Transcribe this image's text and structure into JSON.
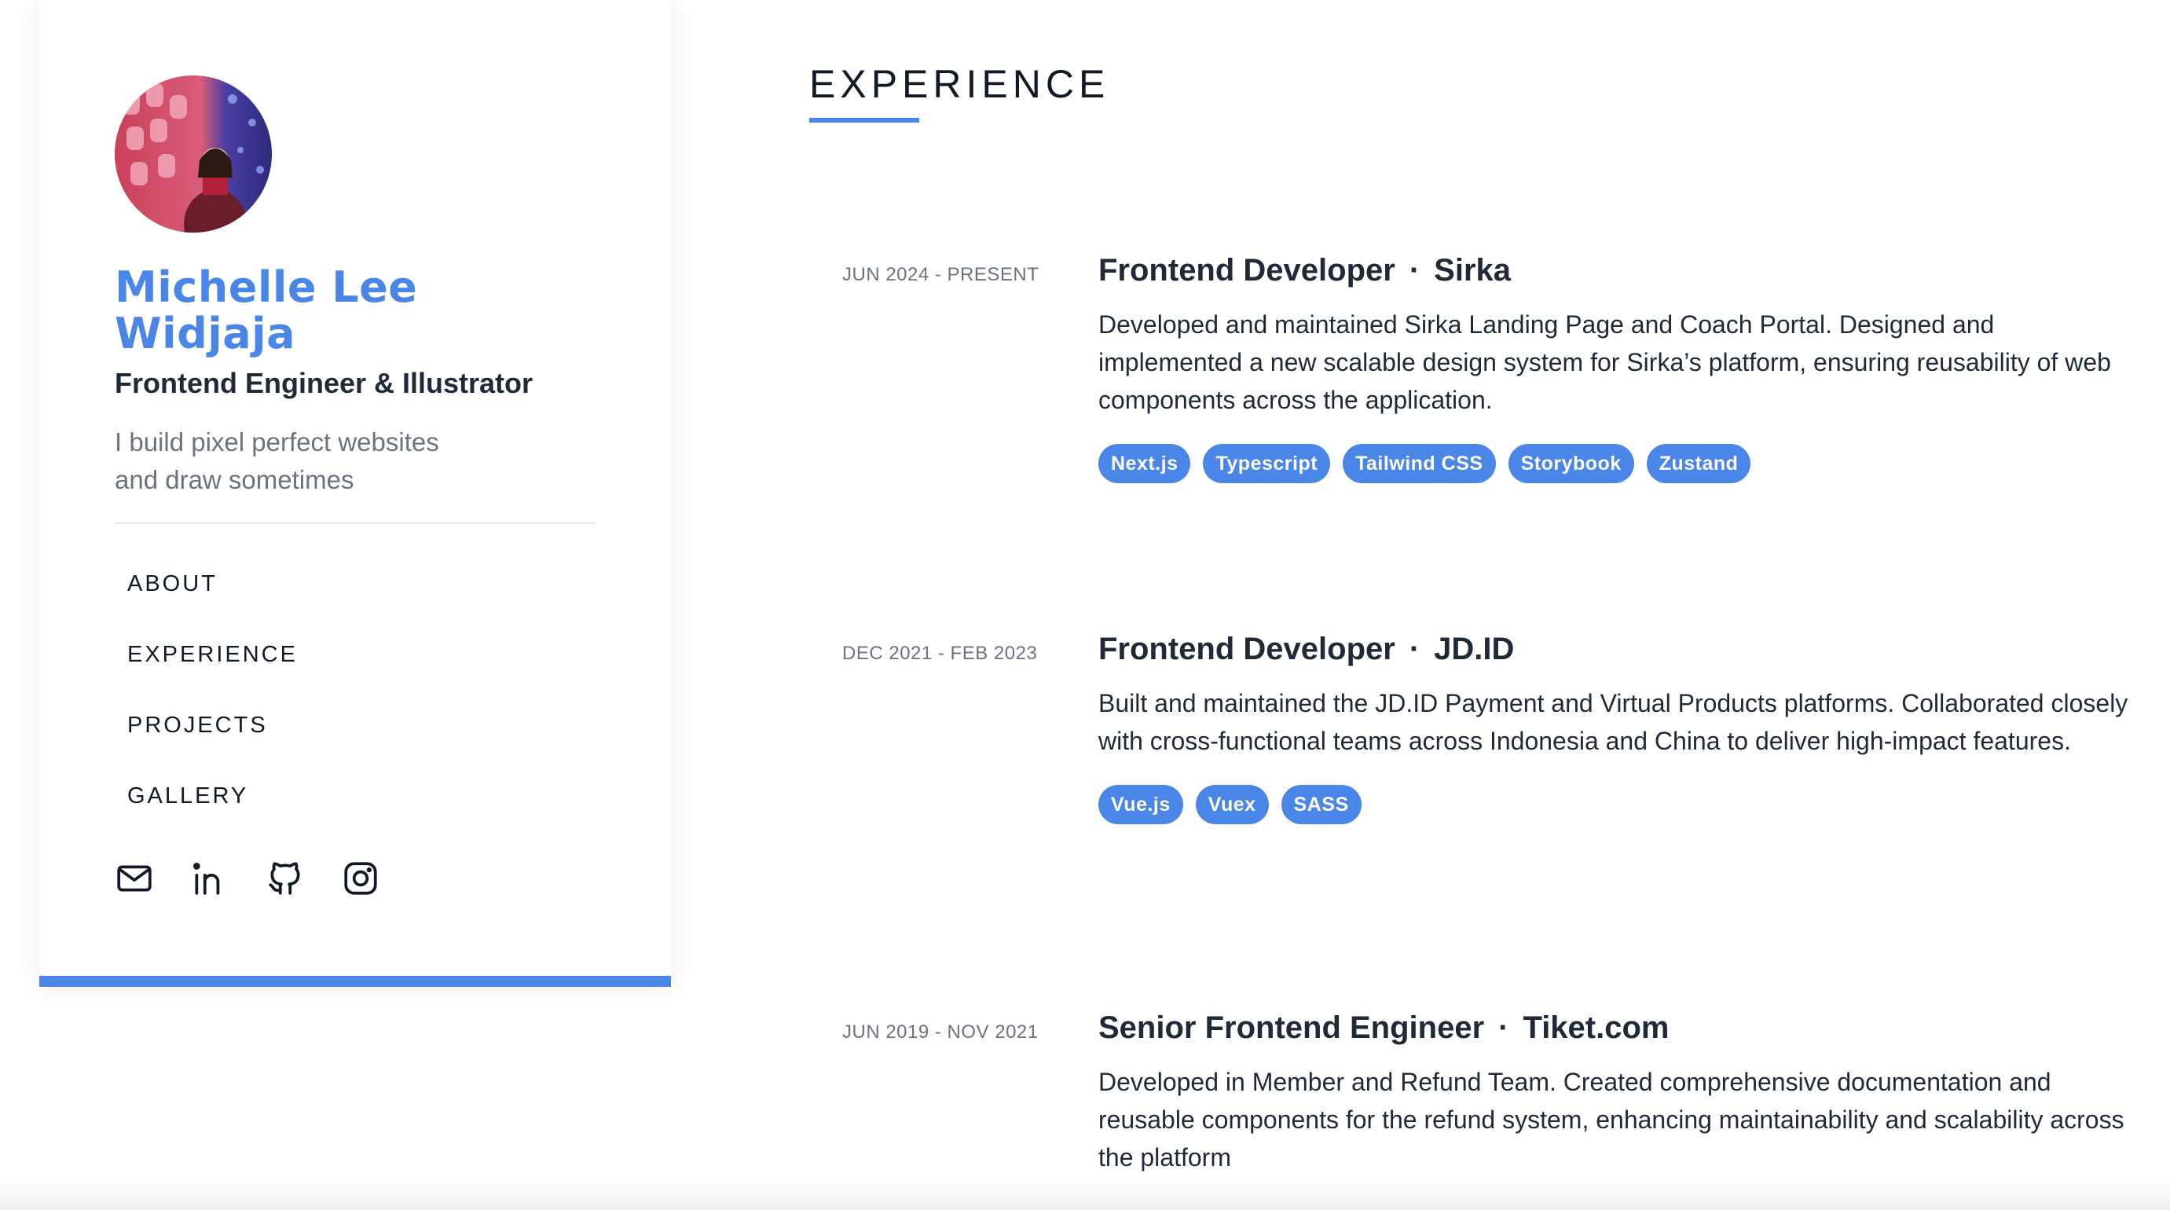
{
  "theme": {
    "accent": "#4a86e8"
  },
  "profile": {
    "name": "Michelle Lee Widjaja",
    "role": "Frontend Engineer & Illustrator",
    "tagline_line1": "I build pixel perfect websites",
    "tagline_line2": "and draw sometimes"
  },
  "nav": {
    "items": [
      {
        "label": "ABOUT"
      },
      {
        "label": "EXPERIENCE"
      },
      {
        "label": "PROJECTS"
      },
      {
        "label": "GALLERY"
      }
    ]
  },
  "socials": {
    "icons": [
      "mail-icon",
      "linkedin-icon",
      "github-icon",
      "instagram-icon"
    ]
  },
  "experience": {
    "heading": "EXPERIENCE",
    "jobs": [
      {
        "date": "JUN 2024 - PRESENT",
        "title": "Frontend Developer",
        "separator": "·",
        "company": "Sirka",
        "description": "Developed and maintained Sirka Landing Page and Coach Portal. Designed and implemented a new scalable design system for Sirka’s platform, ensuring reusability of web components across the application.",
        "tags": [
          "Next.js",
          "Typescript",
          "Tailwind CSS",
          "Storybook",
          "Zustand"
        ]
      },
      {
        "date": "DEC 2021 - FEB 2023",
        "title": "Frontend Developer",
        "separator": "·",
        "company": "JD.ID",
        "description": "Built and maintained the JD.ID Payment and Virtual Products platforms. Collaborated closely with cross-functional teams across Indonesia and China to deliver high-impact features.",
        "tags": [
          "Vue.js",
          "Vuex",
          "SASS"
        ]
      },
      {
        "date": "JUN 2019 - NOV 2021",
        "title": "Senior Frontend Engineer",
        "separator": "·",
        "company": "Tiket.com",
        "description": "Developed in Member and Refund Team. Created comprehensive documentation and reusable components for the refund system, enhancing maintainability and scalability across the platform",
        "tags": []
      }
    ]
  }
}
